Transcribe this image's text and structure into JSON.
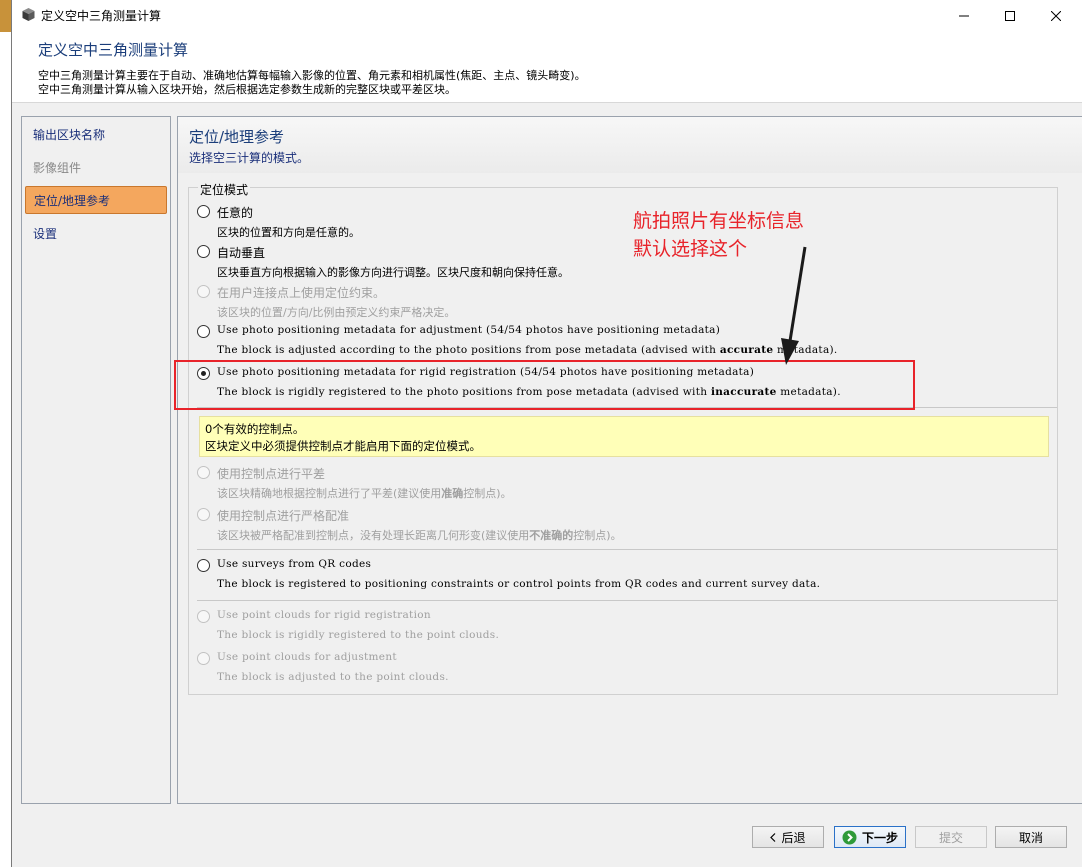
{
  "window": {
    "title": "定义空中三角测量计算"
  },
  "header": {
    "title": "定义空中三角测量计算",
    "description_line1": "空中三角测量计算主要在于自动、准确地估算每幅输入影像的位置、角元素和相机属性(焦距、主点、镜头畸变)。",
    "description_line2": "空中三角测量计算从输入区块开始，然后根据选定参数生成新的完整区块或平差区块。"
  },
  "sidebar": {
    "items": [
      {
        "label": "输出区块名称",
        "state": "enabled"
      },
      {
        "label": "影像组件",
        "state": "disabled"
      },
      {
        "label": "定位/地理参考",
        "state": "active"
      },
      {
        "label": "设置",
        "state": "enabled"
      }
    ]
  },
  "content": {
    "title": "定位/地理参考",
    "subtitle": "选择空三计算的模式。",
    "group_label": "定位模式",
    "options": [
      {
        "label": "任意的",
        "desc": "区块的位置和方向是任意的。",
        "checked": false,
        "enabled": true
      },
      {
        "label": "自动垂直",
        "desc": "区块垂直方向根据输入的影像方向进行调整。区块尺度和朝向保持任意。",
        "checked": false,
        "enabled": true
      },
      {
        "label": "在用户连接点上使用定位约束。",
        "desc": "该区块的位置/方向/比例由预定义约束严格决定。",
        "checked": false,
        "enabled": false
      },
      {
        "label": "Use photo positioning metadata for adjustment (54/54 photos have positioning metadata)",
        "desc_before": "The block is adjusted according to the photo positions from pose metadata (advised with ",
        "desc_bold": "accurate",
        "desc_after": " metadata).",
        "checked": false,
        "enabled": true
      },
      {
        "label": "Use photo positioning metadata for rigid registration (54/54 photos have positioning metadata)",
        "desc_before": "The block is rigidly registered to the photo positions from pose metadata (advised with ",
        "desc_bold": "inaccurate",
        "desc_after": " metadata).",
        "checked": true,
        "enabled": true
      },
      {
        "label": "使用控制点进行平差",
        "desc_before": "该区块精确地根据控制点进行了平差(建议使用",
        "desc_bold": "准确",
        "desc_after": "控制点)。",
        "checked": false,
        "enabled": false
      },
      {
        "label": "使用控制点进行严格配准",
        "desc_before": "该区块被严格配准到控制点，没有处理长距离几何形变(建议使用",
        "desc_bold": "不准确的",
        "desc_after": "控制点)。",
        "checked": false,
        "enabled": false
      },
      {
        "label": "Use surveys from QR codes",
        "desc": "The block is registered to positioning constraints or control points from QR codes and current survey data.",
        "checked": false,
        "enabled": true
      },
      {
        "label": "Use point clouds for rigid registration",
        "desc": "The block is rigidly registered to the point clouds.",
        "checked": false,
        "enabled": false
      },
      {
        "label": "Use point clouds for adjustment",
        "desc": "The block is adjusted to the point clouds.",
        "checked": false,
        "enabled": false
      }
    ],
    "notice_line1": "0个有效的控制点。",
    "notice_line2": "区块定义中必须提供控制点才能启用下面的定位模式。"
  },
  "annotation": {
    "line1": "航拍照片有坐标信息",
    "line2": "默认选择这个",
    "color": "#e8232a"
  },
  "footer": {
    "back_label": "后退",
    "next_label": "下一步",
    "submit_label": "提交",
    "cancel_label": "取消"
  },
  "colors": {
    "active_nav": "#f4a75e",
    "title_blue": "#1a3d7a",
    "notice_bg": "#ffffb8"
  }
}
